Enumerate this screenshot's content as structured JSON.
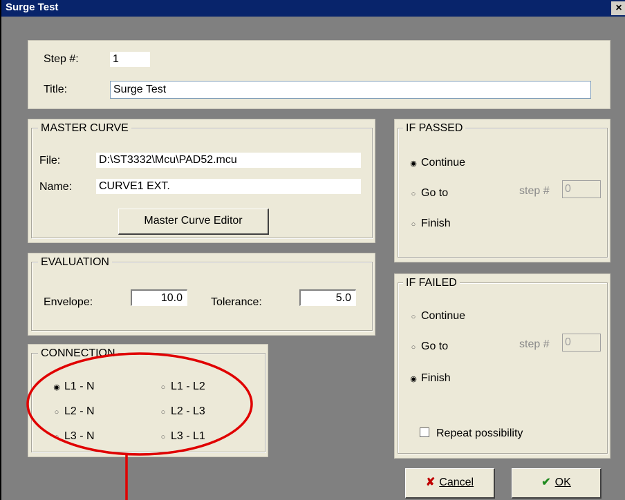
{
  "window": {
    "title": "Surge Test",
    "close_glyph": "×"
  },
  "step": {
    "label": "Step #:",
    "value": "1",
    "title_label": "Title:",
    "title_value": "Surge Test"
  },
  "master_curve": {
    "legend": "MASTER CURVE",
    "file_label": "File:",
    "file_value": "D:\\ST3332\\Mcu\\PAD52.mcu",
    "name_label": "Name:",
    "name_value": "CURVE1 EXT.",
    "editor_button": "Master Curve Editor"
  },
  "evaluation": {
    "legend": "EVALUATION",
    "envelope_label": "Envelope:",
    "envelope_value": "10.0",
    "tolerance_label": "Tolerance:",
    "tolerance_value": "5.0"
  },
  "connection": {
    "legend": "CONNECTION",
    "options": [
      "L1 - N",
      "L2 - N",
      "L3 - N",
      "L1 - L2",
      "L2 - L3",
      "L3 - L1"
    ],
    "selected": "L1 - N"
  },
  "if_passed": {
    "legend": "IF PASSED",
    "continue": "Continue",
    "goto": "Go to",
    "finish": "Finish",
    "step_label": "step #",
    "step_value": "0",
    "selected": "Continue"
  },
  "if_failed": {
    "legend": "IF FAILED",
    "continue": "Continue",
    "goto": "Go to",
    "finish": "Finish",
    "step_label": "step #",
    "step_value": "0",
    "selected": "Finish",
    "repeat_label": "Repeat possibility"
  },
  "buttons": {
    "cancel_label": "Cancel",
    "ok_label": "OK",
    "cancel_icon": "x-icon",
    "ok_icon": "check-icon"
  },
  "colors": {
    "title_bar": "#08246b",
    "panel": "#ece9d8",
    "annotation": "#e00000"
  }
}
